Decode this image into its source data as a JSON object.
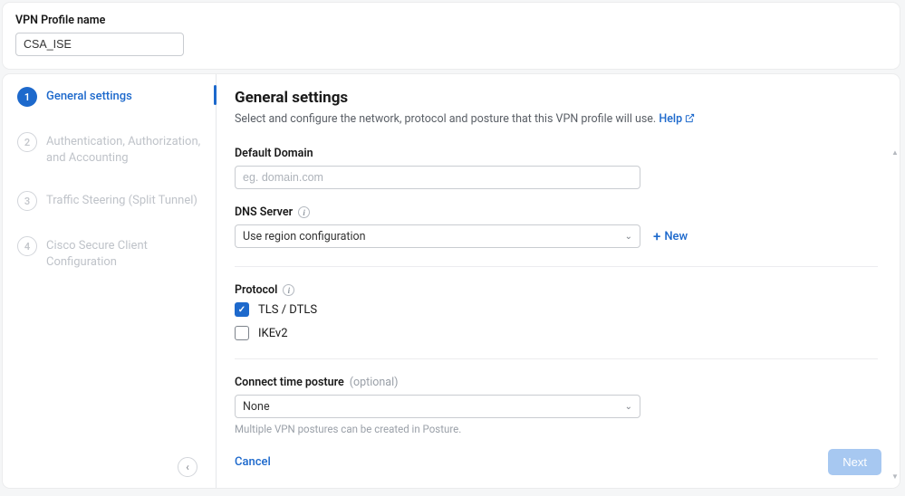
{
  "header": {
    "profile_label": "VPN Profile name",
    "profile_value": "CSA_ISE"
  },
  "steps": [
    {
      "num": "1",
      "label": "General settings",
      "active": true
    },
    {
      "num": "2",
      "label": "Authentication, Authorization, and Accounting",
      "active": false
    },
    {
      "num": "3",
      "label": "Traffic Steering (Split Tunnel)",
      "active": false
    },
    {
      "num": "4",
      "label": "Cisco Secure Client Configuration",
      "active": false
    }
  ],
  "main": {
    "title": "General settings",
    "desc": "Select and configure the network, protocol and posture that this VPN profile will use.",
    "help_label": "Help",
    "default_domain": {
      "label": "Default Domain",
      "placeholder": "eg. domain.com",
      "value": ""
    },
    "dns": {
      "label": "DNS Server",
      "selected": "Use region configuration",
      "new_label": "New"
    },
    "protocol": {
      "label": "Protocol",
      "options": [
        {
          "label": "TLS / DTLS",
          "checked": true
        },
        {
          "label": "IKEv2",
          "checked": false
        }
      ]
    },
    "posture": {
      "label": "Connect time posture",
      "optional": "(optional)",
      "selected": "None",
      "hint": "Multiple VPN postures can be created in Posture."
    },
    "cancel": "Cancel",
    "next": "Next"
  }
}
